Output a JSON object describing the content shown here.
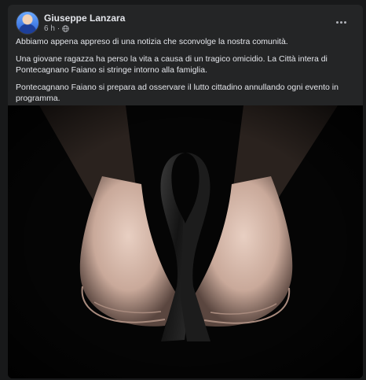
{
  "post": {
    "author": "Giuseppe Lanzara",
    "time": "6 h",
    "separator": "·",
    "privacy_icon": "globe-icon",
    "menu_icon": "more-options-icon",
    "paragraphs": [
      "Abbiamo appena appreso di una notizia che sconvolge la nostra comunità.",
      "Una giovane ragazza ha perso la vita a causa di un tragico omicidio. La Città intera di Pontecagnano Faiano si stringe intorno alla famiglia.",
      "Pontecagnano Faiano si prepara ad osservare il lutto cittadino annullando ogni evento in programma."
    ],
    "image": "hands-holding-black-mourning-ribbon"
  },
  "colors": {
    "background": "#18191a",
    "card": "#242526",
    "text_primary": "#e4e6eb",
    "text_secondary": "#b0b3b8",
    "ribbon": "#1a1a1a"
  }
}
